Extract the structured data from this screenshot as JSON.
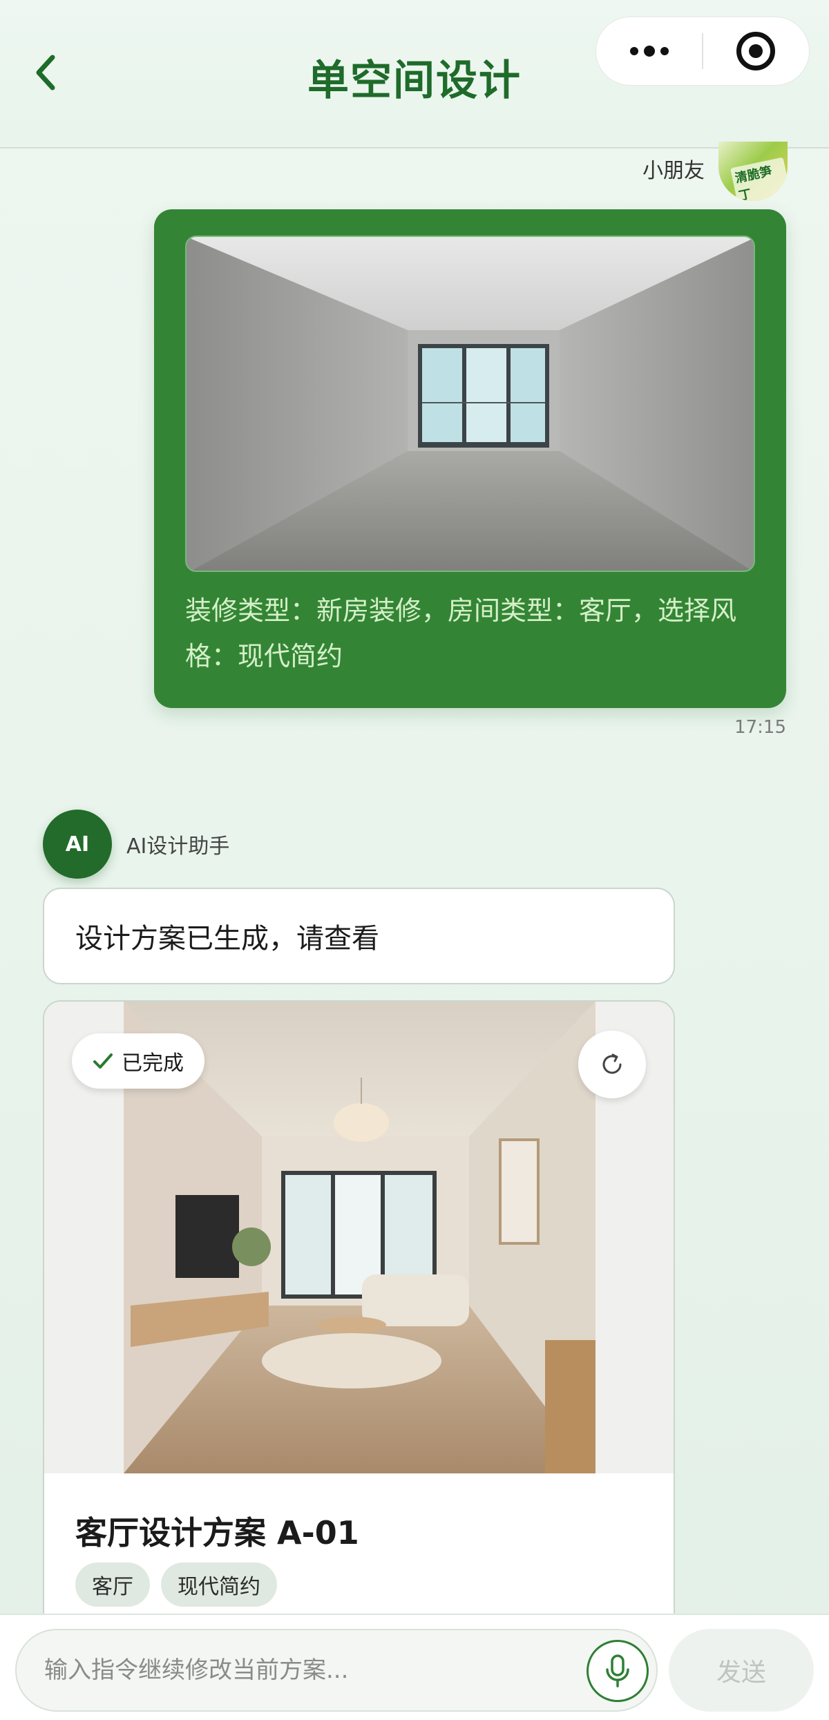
{
  "header": {
    "title": "单空间设计",
    "back_icon": "chevron-left-icon",
    "more_icon": "more-dots-icon",
    "close_icon": "target-circle-icon"
  },
  "user_message": {
    "name": "小朋友",
    "avatar_label": "清脆笋丁",
    "image": "empty-room-photo",
    "text": "装修类型：新房装修，房间类型：客厅，选择风格：现代简约",
    "time": "17:15"
  },
  "ai_message": {
    "avatar_text": "AI",
    "name": "AI设计助手",
    "text": "设计方案已生成，请查看"
  },
  "design_card": {
    "status": "已完成",
    "status_icon": "check-icon",
    "refresh_icon": "refresh-icon",
    "image": "living-room-design-render",
    "title": "客厅设计方案 A-01",
    "tags": [
      "客厅",
      "现代简约"
    ]
  },
  "input_bar": {
    "placeholder": "输入指令继续修改当前方案...",
    "mic_icon": "microphone-icon",
    "send_label": "发送"
  },
  "colors": {
    "primary_green": "#338535",
    "title_green": "#1f6b2a",
    "avatar_green": "#226b2a"
  }
}
